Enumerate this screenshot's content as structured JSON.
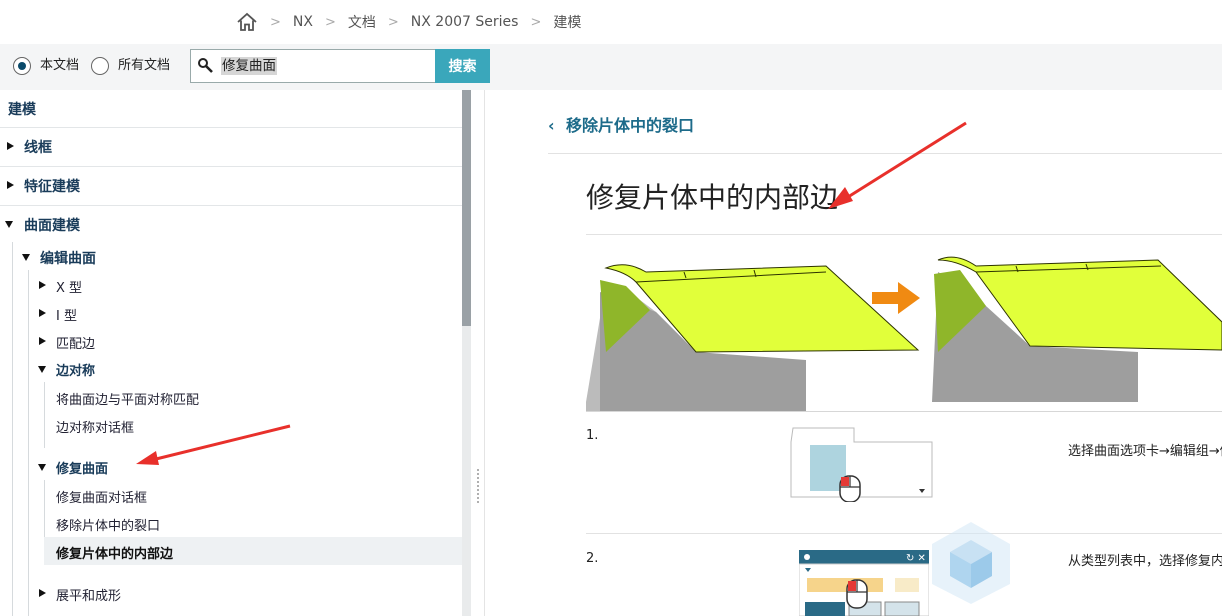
{
  "breadcrumb": {
    "items": [
      "NX",
      "文档",
      "NX 2007 Series",
      "建模"
    ]
  },
  "search": {
    "scope_current": "本文档",
    "scope_all": "所有文档",
    "query": "修复曲面",
    "button": "搜索"
  },
  "sidebar": {
    "title": "建模",
    "wireframe": "线框",
    "feature_modeling": "特征建模",
    "surface_modeling": "曲面建模",
    "edit_surface": "编辑曲面",
    "x_type": "X 型",
    "i_type": "I 型",
    "match_edge": "匹配边",
    "edge_symmetry": "边对称",
    "edge_sym_item1": "将曲面边与平面对称匹配",
    "edge_sym_item2": "边对称对话框",
    "repair_surface": "修复曲面",
    "repair_item1": "修复曲面对话框",
    "repair_item2": "移除片体中的裂口",
    "repair_item3": "修复片体中的内部边",
    "flatten": "展平和成形"
  },
  "content": {
    "back_link": "移除片体中的裂口",
    "title": "修复片体中的内部边",
    "step1_num": "1.",
    "step1_text": "选择曲面选项卡→编辑组→修",
    "step2_num": "2.",
    "step2_text": "从类型列表中，选择修复内"
  },
  "colors": {
    "accent": "#3aa7bb",
    "link": "#1d6b8a",
    "surface_yellow": "#e1ff3a",
    "arrow_orange": "#f08a12",
    "annotation_red": "#e8302b"
  }
}
